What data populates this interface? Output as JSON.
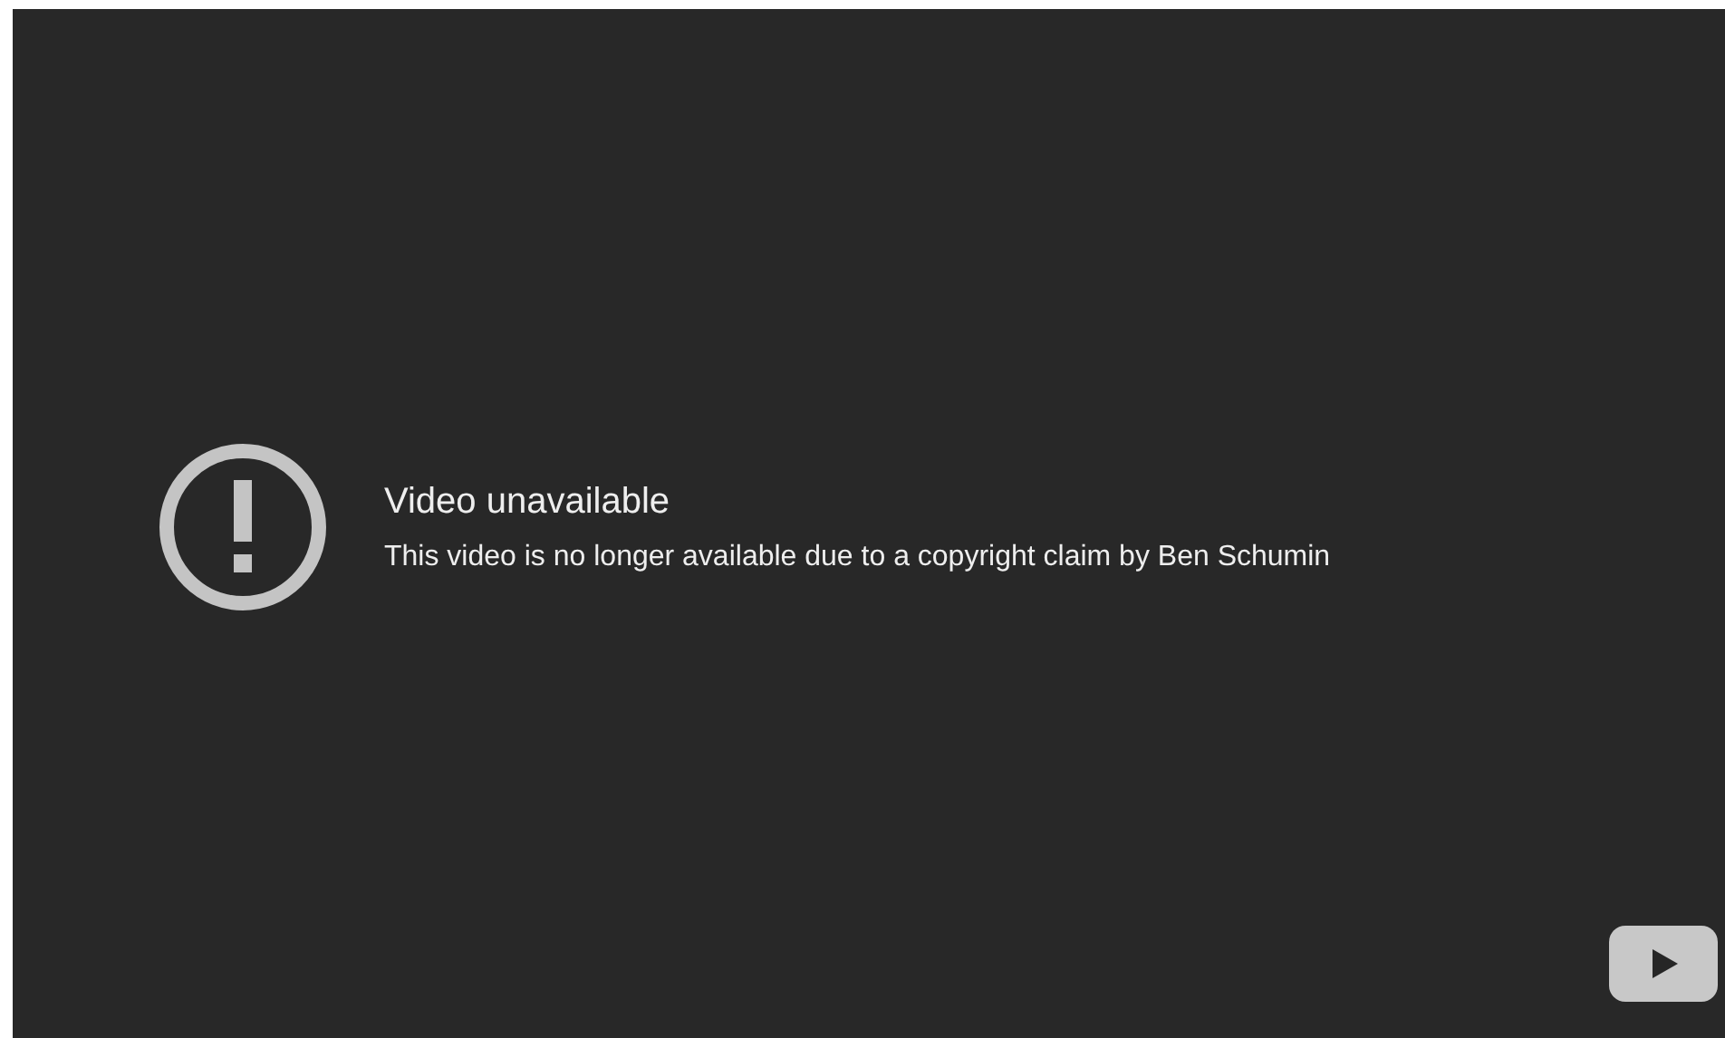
{
  "error": {
    "title": "Video unavailable",
    "message": "This video is no longer available due to a copyright claim by Ben Schumin"
  }
}
